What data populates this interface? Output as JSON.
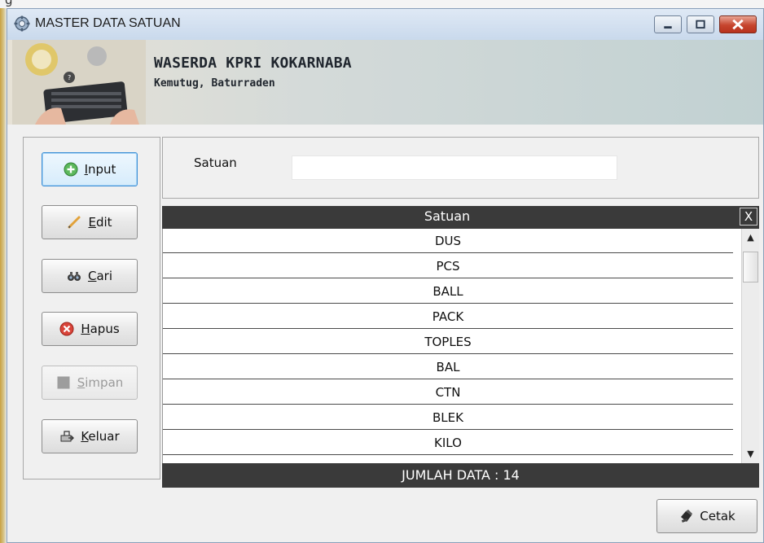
{
  "window": {
    "title": "MASTER DATA SATUAN",
    "controls": [
      "minimize",
      "maximize",
      "close"
    ]
  },
  "header": {
    "org_name": "WASERDA KPRI KOKARNABA",
    "org_location": "Kemutug, Baturraden"
  },
  "buttons": {
    "input": "Input",
    "edit": "Edit",
    "cari": "Cari",
    "hapus": "Hapus",
    "simpan": "Simpan",
    "keluar": "Keluar",
    "cetak": "Cetak"
  },
  "form": {
    "satuan_label": "Satuan",
    "satuan_value": ""
  },
  "table": {
    "column_header": "Satuan",
    "close_glyph": "X",
    "rows": [
      "DUS",
      "PCS",
      "BALL",
      "PACK",
      "TOPLES",
      "BAL",
      "CTN",
      "BLEK",
      "KILO"
    ],
    "footer": "JUMLAH DATA : 14"
  },
  "icons": {
    "app": "gear-app-icon",
    "input": "green-plus-circle-icon",
    "edit": "pencil-icon",
    "cari": "binoculars-icon",
    "hapus": "red-x-circle-icon",
    "simpan": "save-square-icon",
    "keluar": "exit-door-icon",
    "cetak": "printer-icon"
  },
  "colors": {
    "table_header_bg": "#3a3a3a",
    "active_button_border": "#3b8ed6",
    "close_button": "#c6452e"
  }
}
